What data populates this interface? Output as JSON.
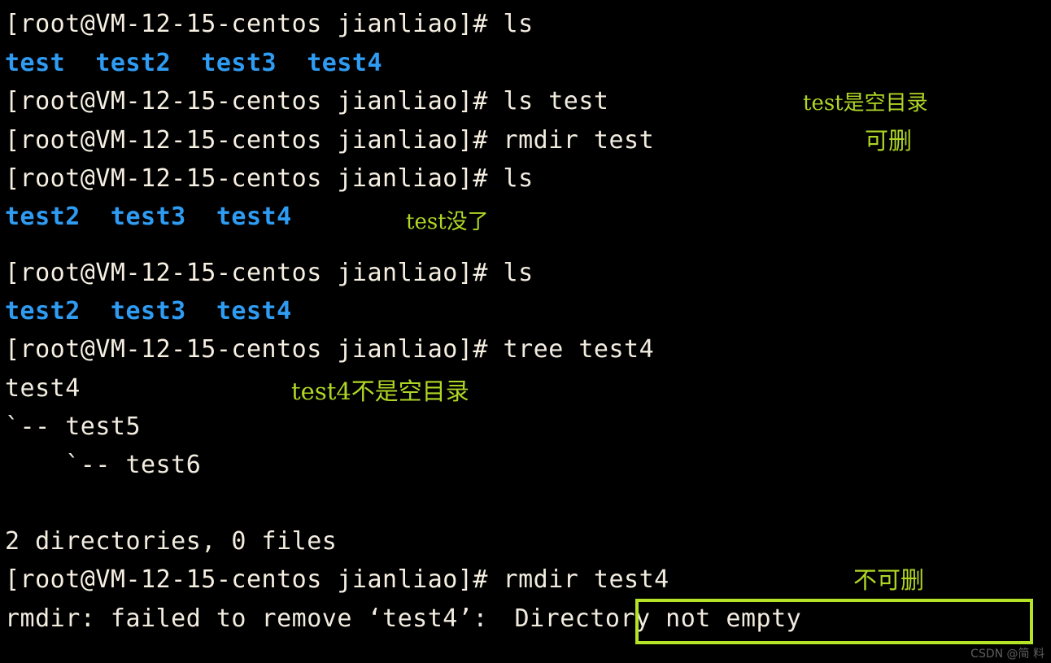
{
  "terminal": {
    "background_color": "#000000",
    "foreground_color": "#f2ece0",
    "dir_color": "#2f9cf4",
    "annotation_color": "#afd626",
    "highlight_border_color": "#b5e427",
    "prompt": "[root@VM-12-15-centos jianliao]# ",
    "lines": [
      {
        "prompt": "[root@VM-12-15-centos jianliao]# ",
        "command": "ls"
      },
      {
        "dirs": "test  test2  test3  test4"
      },
      {
        "prompt": "[root@VM-12-15-centos jianliao]# ",
        "command": "ls test"
      },
      {
        "prompt": "[root@VM-12-15-centos jianliao]# ",
        "command": "rmdir test"
      },
      {
        "prompt": "[root@VM-12-15-centos jianliao]# ",
        "command": "ls"
      },
      {
        "dirs": "test2  test3  test4"
      },
      {
        "blank": ""
      },
      {
        "prompt": "[root@VM-12-15-centos jianliao]# ",
        "command": "ls"
      },
      {
        "dirs": "test2  test3  test4"
      },
      {
        "prompt": "[root@VM-12-15-centos jianliao]# ",
        "command": "tree test4"
      },
      {
        "output": "test4"
      },
      {
        "output": "`-- test5"
      },
      {
        "output": "    `-- test6"
      },
      {
        "blank": ""
      },
      {
        "output": "2 directories, 0 files"
      },
      {
        "prompt": "[root@VM-12-15-centos jianliao]# ",
        "command": "rmdir test4"
      },
      {
        "output": "rmdir: failed to remove ‘test4’: ",
        "highlight": "Directory not empty"
      }
    ]
  },
  "annotations": [
    {
      "name": "annotation-test-empty-dir",
      "text": "test是空目录"
    },
    {
      "name": "annotation-can-delete",
      "text": "可删"
    },
    {
      "name": "annotation-test-gone",
      "text": "test没了"
    },
    {
      "name": "annotation-test4-not-empty",
      "text": "test4不是空目录"
    },
    {
      "name": "annotation-cannot-delete",
      "text": "不可删"
    }
  ],
  "watermark": {
    "text": "CSDN @简 料"
  }
}
